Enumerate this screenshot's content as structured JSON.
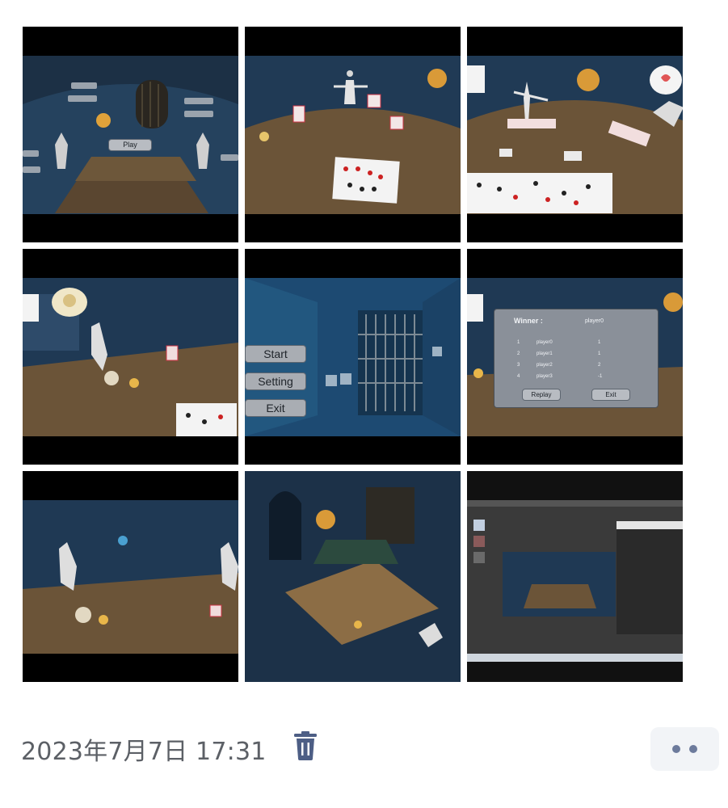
{
  "tiles": [
    {
      "id": "lobby-table",
      "play_label": "Play"
    },
    {
      "id": "cards-skeleton"
    },
    {
      "id": "card-hands"
    },
    {
      "id": "skeleton-lying"
    },
    {
      "id": "start-menu",
      "menu": {
        "start": "Start",
        "setting": "Setting",
        "exit": "Exit"
      }
    },
    {
      "id": "winner-dialog",
      "winner": {
        "title": "Winner :",
        "name": "player0",
        "rows": [
          {
            "rank": "1",
            "player": "player0",
            "score": "1"
          },
          {
            "rank": "2",
            "player": "player1",
            "score": "1"
          },
          {
            "rank": "3",
            "player": "player2",
            "score": "2"
          },
          {
            "rank": "4",
            "player": "player3",
            "score": "-1"
          }
        ],
        "replay": "Replay",
        "exit": "Exit"
      }
    },
    {
      "id": "skeletons-table"
    },
    {
      "id": "room-overview"
    },
    {
      "id": "editor-screenshot"
    }
  ],
  "footer": {
    "datetime": "2023年7月7日 17:31",
    "delete_icon": "trash-icon",
    "more_icon": "more-dots-icon"
  },
  "colors": {
    "scene_blue": "#1f3a56",
    "table_wood": "#6a5338",
    "footer_text": "#5c6066",
    "icon_blue": "#4d5e85",
    "more_bg": "#f2f4f7"
  }
}
